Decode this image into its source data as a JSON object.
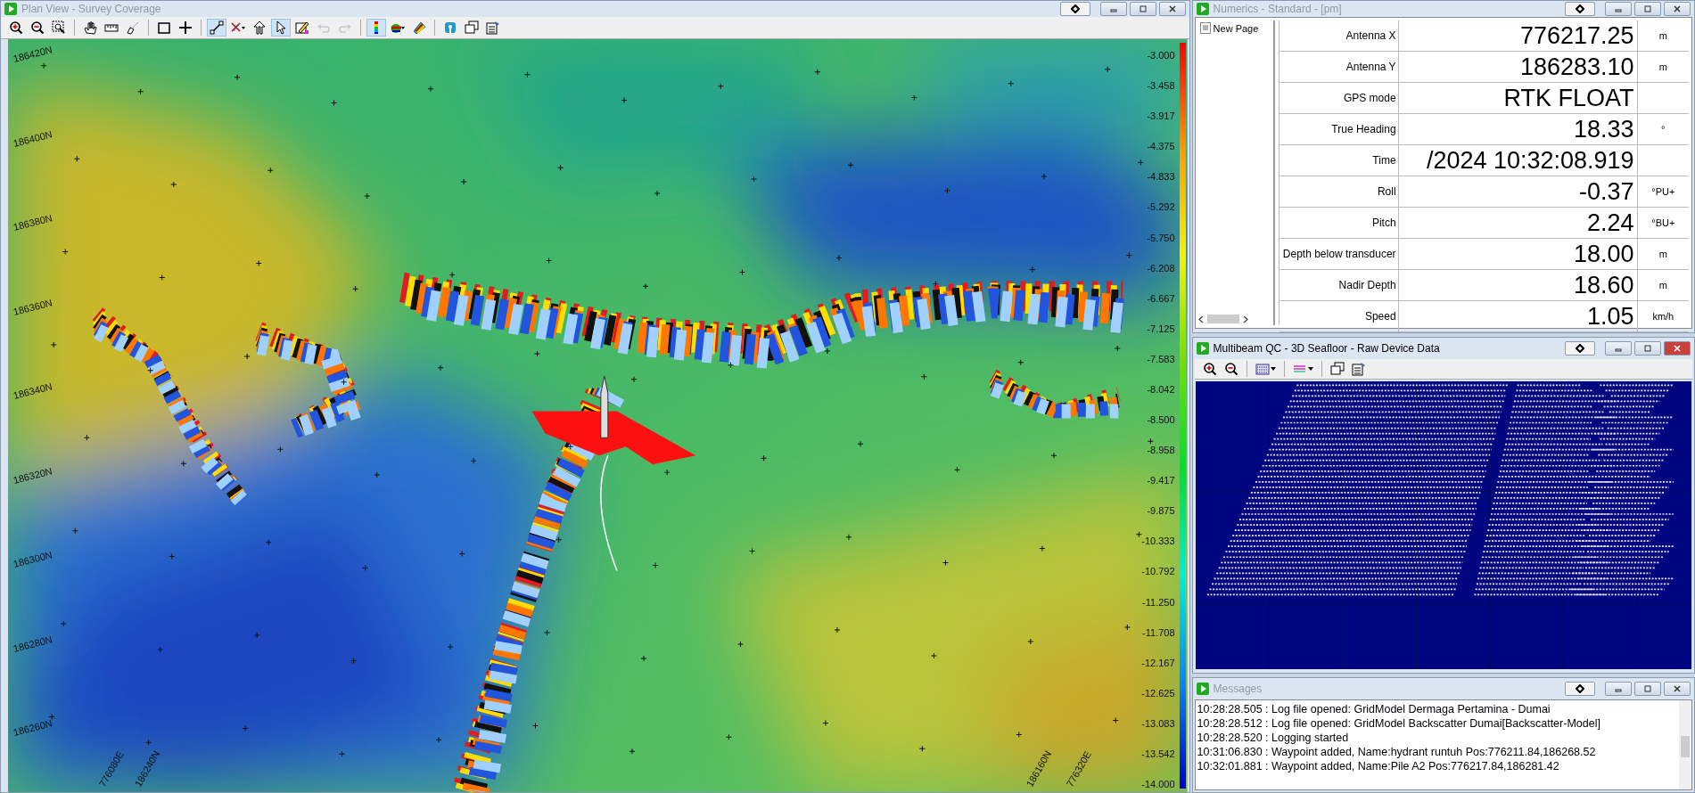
{
  "plan_view": {
    "title": "Plan View - Survey Coverage",
    "active": false,
    "toolbar": [
      {
        "kind": "zoom-in",
        "selected": false,
        "disabled": false
      },
      {
        "kind": "zoom-out",
        "selected": false,
        "disabled": false
      },
      {
        "kind": "zoom-box",
        "selected": false,
        "disabled": false
      },
      {
        "kind": "sep"
      },
      {
        "kind": "pan",
        "selected": false,
        "disabled": false
      },
      {
        "kind": "ruler",
        "selected": false,
        "disabled": false
      },
      {
        "kind": "probe",
        "selected": false,
        "disabled": false
      },
      {
        "kind": "sep"
      },
      {
        "kind": "rect",
        "selected": false,
        "disabled": false
      },
      {
        "kind": "cross",
        "selected": false,
        "disabled": false
      },
      {
        "kind": "sep"
      },
      {
        "kind": "line",
        "selected": true,
        "disabled": false
      },
      {
        "kind": "filter",
        "selected": false,
        "disabled": false
      },
      {
        "kind": "up",
        "selected": false,
        "disabled": false
      },
      {
        "kind": "pointer",
        "selected": true,
        "disabled": false
      },
      {
        "kind": "edit",
        "selected": false,
        "disabled": false
      },
      {
        "kind": "undo",
        "selected": false,
        "disabled": true
      },
      {
        "kind": "redo",
        "selected": false,
        "disabled": true
      },
      {
        "kind": "sep"
      },
      {
        "kind": "colorbar",
        "selected": true,
        "disabled": false
      },
      {
        "kind": "palette",
        "selected": false,
        "disabled": false
      },
      {
        "kind": "paint",
        "selected": false,
        "disabled": false
      },
      {
        "kind": "sep"
      },
      {
        "kind": "antenna",
        "selected": false,
        "disabled": false
      },
      {
        "kind": "windows",
        "selected": false,
        "disabled": false
      },
      {
        "kind": "properties",
        "selected": false,
        "disabled": false
      }
    ],
    "northing_labels": [
      "186420N",
      "186400N",
      "186380N",
      "186360N",
      "186340N",
      "186320N",
      "186300N",
      "186280N",
      "186260N"
    ],
    "bottom_labels": [
      "776080E",
      "186240N",
      "186160N",
      "776320E"
    ],
    "scale_labels": [
      "-3.000",
      "-3.458",
      "-3.917",
      "-4.375",
      "-4.833",
      "-5.292",
      "-5.750",
      "-6.208",
      "-6.667",
      "-7.125",
      "-7.583",
      "-8.042",
      "-8.500",
      "-8.958",
      "-9.417",
      "-9.875",
      "-10.333",
      "-10.792",
      "-11.250",
      "-11.708",
      "-12.167",
      "-12.625",
      "-13.083",
      "-13.542",
      "-14.000"
    ]
  },
  "numerics": {
    "title": "Numerics - Standard - [pm]",
    "active": false,
    "page": "New Page",
    "rows": [
      {
        "label": "Antenna X",
        "value": "776217.25",
        "unit": "m"
      },
      {
        "label": "Antenna Y",
        "value": "186283.10",
        "unit": "m"
      },
      {
        "label": "GPS mode",
        "value": "RTK FLOAT"
      },
      {
        "label": "True Heading",
        "value": "18.33",
        "unit": "°"
      },
      {
        "label": "Time",
        "value": "/2024 10:32:08.919"
      },
      {
        "label": "Roll",
        "value": "-0.37",
        "unit": "°PU+"
      },
      {
        "label": "Pitch",
        "value": "2.24",
        "unit": "°BU+"
      },
      {
        "label": "Depth below transducer",
        "value": "18.00",
        "unit": "m"
      },
      {
        "label": "Nadir Depth",
        "value": "18.60",
        "unit": "m"
      },
      {
        "label": "Speed",
        "value": "1.05",
        "unit": "km/h"
      }
    ]
  },
  "multibeam": {
    "title": "Multibeam QC - 3D Seafloor - Raw Device Data",
    "active": true,
    "toolbar": [
      {
        "kind": "zoom-in",
        "selected": false,
        "disabled": false
      },
      {
        "kind": "zoom-out",
        "selected": false,
        "disabled": false
      },
      {
        "kind": "sep"
      },
      {
        "kind": "points",
        "selected": false,
        "disabled": false
      },
      {
        "kind": "sep"
      },
      {
        "kind": "layers",
        "selected": false,
        "disabled": false
      },
      {
        "kind": "sep"
      },
      {
        "kind": "windows",
        "selected": false,
        "disabled": false
      },
      {
        "kind": "properties",
        "selected": false,
        "disabled": false
      }
    ]
  },
  "messages": {
    "title": "Messages",
    "active": false,
    "lines": [
      "10:28:28.505 : Log file opened: GridModel Dermaga Pertamina - Dumai",
      "10:28:28.512 : Log file opened: GridModel Backscatter Dumai[Backscatter-Model]",
      "10:28:28.520 : Logging started",
      "10:31:06.830 : Waypoint added, Name:hydrant runtuh Pos:776211.84,186268.52",
      "10:32:01.881 : Waypoint added, Name:Pile A2 Pos:776217.84,186281.42"
    ]
  }
}
